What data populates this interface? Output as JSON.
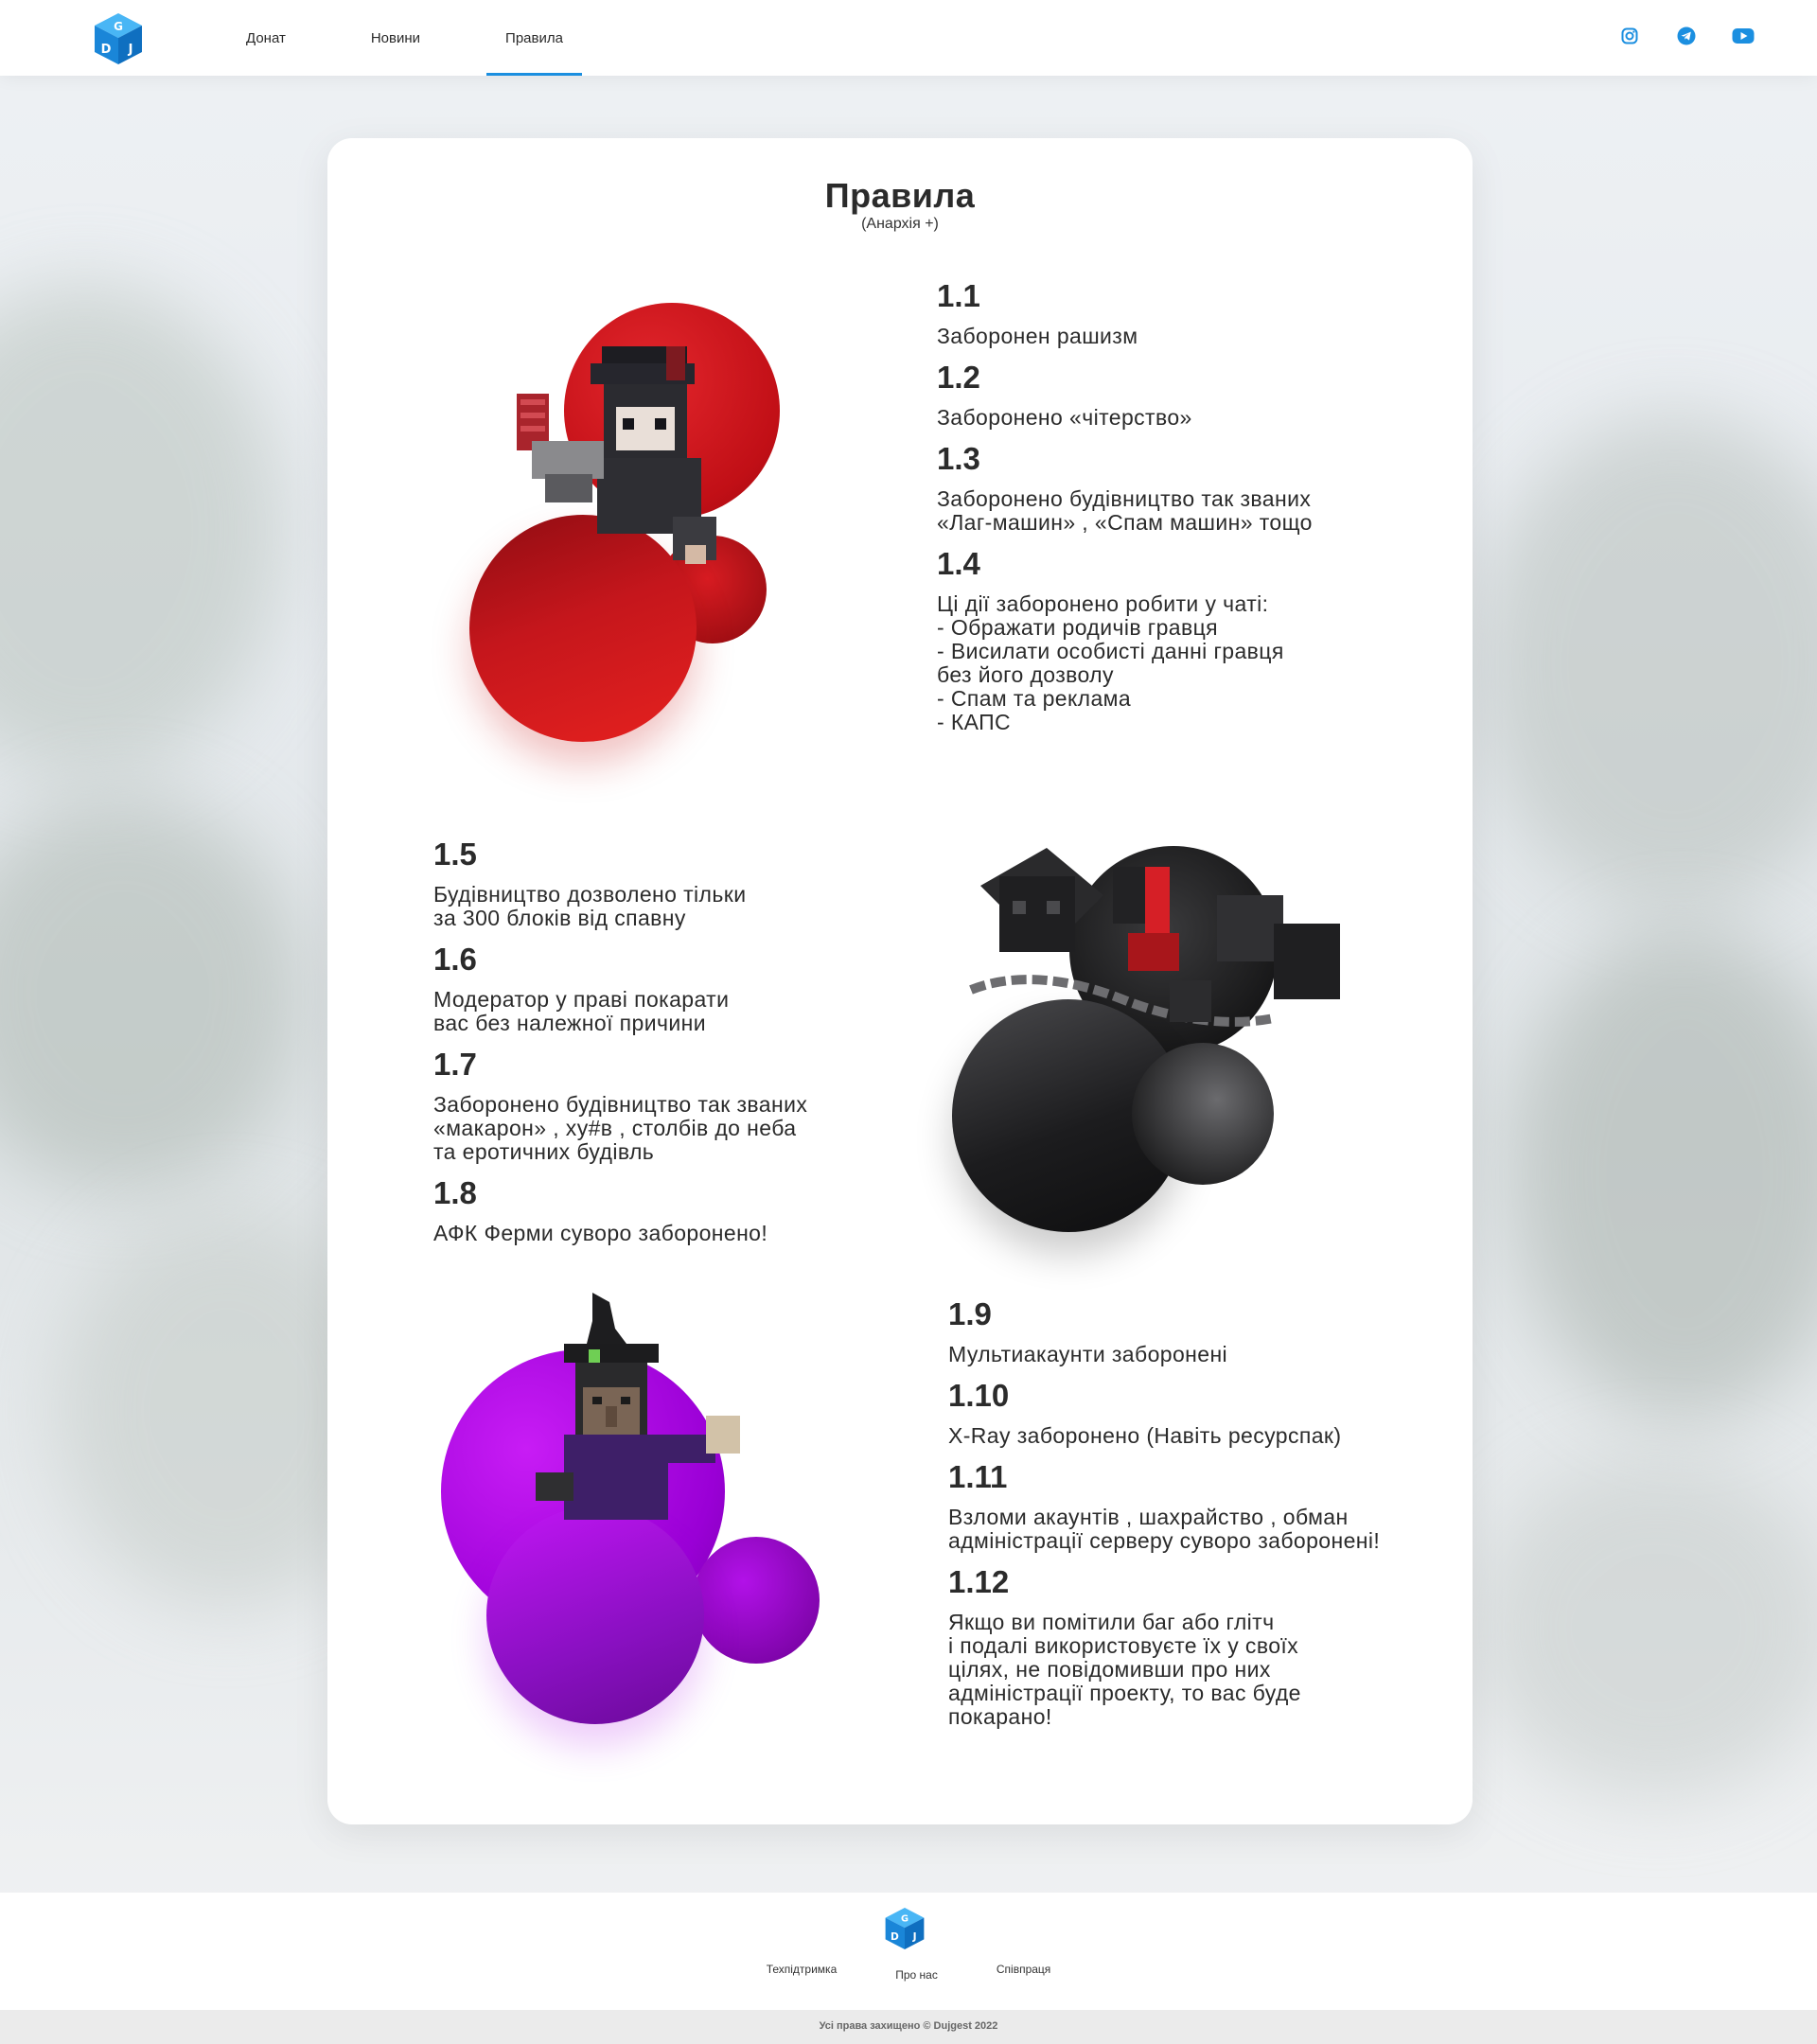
{
  "header": {
    "nav": [
      {
        "label": "Донат"
      },
      {
        "label": "Новини"
      },
      {
        "label": "Правила",
        "active": true
      }
    ],
    "socials": [
      {
        "icon": "instagram-icon"
      },
      {
        "icon": "telegram-icon"
      },
      {
        "icon": "youtube-icon"
      }
    ]
  },
  "page": {
    "title": "Правила",
    "subtitle": "(Анархія +)"
  },
  "rules": [
    {
      "num": "1.1",
      "text": "Заборонен рашизм"
    },
    {
      "num": "1.2",
      "text": "Заборонено «чітерство»"
    },
    {
      "num": "1.3",
      "text": "Заборонено будівництво так званих\n«Лаг-машин» , «Спам машин» тощо"
    },
    {
      "num": "1.4",
      "text": "Ці дії заборонено робити у чаті:\n- Ображати родичів гравця\n- Висилати особисті данні гравця\n   без його дозволу\n- Спам та реклама\n- КАПС"
    },
    {
      "num": "1.5",
      "text": "Будівництво дозволено тільки\nза 300 блоків від спавну"
    },
    {
      "num": "1.6",
      "text": "Модератор у праві покарати\nвас без належної причини"
    },
    {
      "num": "1.7",
      "text": "Заборонено будівництво так званих\n«макарон» , ху#в , столбів до неба\nта еротичних будівль"
    },
    {
      "num": "1.8",
      "text": "АФК Ферми суворо заборонено!"
    },
    {
      "num": "1.9",
      "text": "Мультиакаунти заборонені"
    },
    {
      "num": "1.10",
      "text": "X-Ray заборонено (Навіть ресурспак)"
    },
    {
      "num": "1.11",
      "text": "Взломи акаунтів , шахрайство , обман\nадміністрації серверу суворо заборонені!"
    },
    {
      "num": "1.12",
      "text": "Якщо ви помітили баг або глітч\n і подалі використовуєте їх у своїх\nцілях, не повідомивши про них\nадміністрації проекту, то вас буде\nпокарано!"
    }
  ],
  "footer": {
    "links": [
      {
        "label": "Техпідтримка"
      },
      {
        "label": "Про нас"
      },
      {
        "label": "Співпраця"
      }
    ],
    "copyright": "Усі права захищено © Dujgest 2022"
  },
  "colors": {
    "accent": "#1b8fe0",
    "red": "#d4151c",
    "dark": "#2a2a2a",
    "purple": "#b400f0"
  }
}
